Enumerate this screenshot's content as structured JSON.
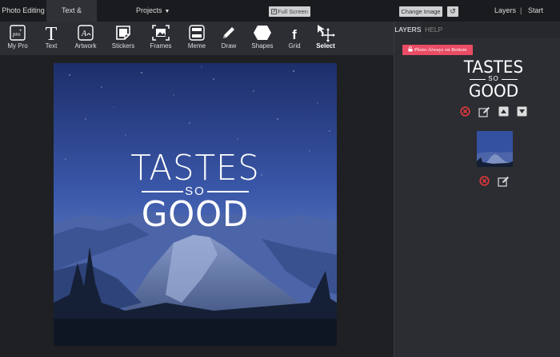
{
  "topbar": {
    "tab_photo_editing": "Photo Editing",
    "tab_text_overlays": "Text & Overlays",
    "projects": "Projects",
    "full_screen": "Full Screen",
    "change_image": "Change Image",
    "layers": "Layers",
    "separator": "|",
    "start_over": "Start Over"
  },
  "toolbar": {
    "tools": [
      {
        "label": "My Pro",
        "icon": "pro-icon"
      },
      {
        "label": "Text",
        "icon": "text-t-icon"
      },
      {
        "label": "Artwork",
        "icon": "artwork-icon"
      },
      {
        "label": "Stickers",
        "icon": "sticker-icon"
      },
      {
        "label": "Frames",
        "icon": "frame-icon"
      },
      {
        "label": "Meme",
        "icon": "meme-icon"
      },
      {
        "label": "Draw",
        "icon": "pencil-icon"
      },
      {
        "label": "Shapes",
        "icon": "hexagon-icon"
      },
      {
        "label": "Grid",
        "icon": "grid-f-icon"
      },
      {
        "label": "Select",
        "icon": "select-move-icon"
      }
    ],
    "active": "Select",
    "pro_badge": "pro",
    "text_glyph": "T",
    "artwork_glyph": "A",
    "grid_glyph": "f"
  },
  "canvas": {
    "overlay_line1": "TASTES",
    "overlay_line2": "SO",
    "overlay_line3": "GOOD"
  },
  "panel": {
    "tab_layers": "LAYERS",
    "tab_help": "HELP",
    "photo_always_bottom": "Photo Always on Bottom",
    "layer_text_line1": "TASTES",
    "layer_text_line2": "SO",
    "layer_text_line3": "GOOD"
  },
  "colors": {
    "accent_red": "#e94c64",
    "delete_red": "#e0383c",
    "panel_bg": "#2b2d32",
    "toolbar_bg": "#2c2e33"
  }
}
